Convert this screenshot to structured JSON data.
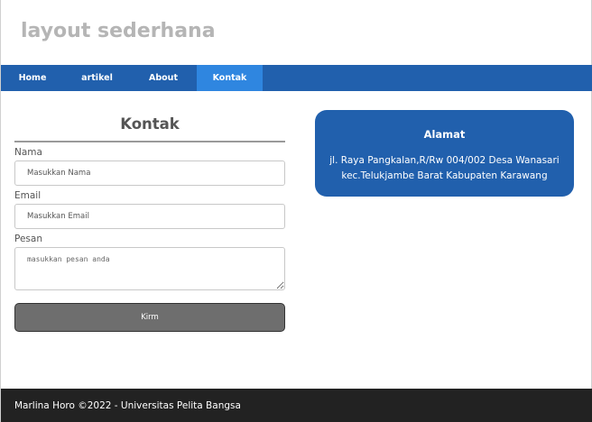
{
  "header": {
    "title": "layout sederhana"
  },
  "nav": {
    "items": [
      {
        "label": "Home"
      },
      {
        "label": "artikel"
      },
      {
        "label": "About"
      },
      {
        "label": "Kontak",
        "active": true
      }
    ]
  },
  "form": {
    "heading": "Kontak",
    "name_label": "Nama",
    "name_placeholder": "Masukkan Nama",
    "email_label": "Email",
    "email_placeholder": "Masukkan Email",
    "message_label": "Pesan",
    "message_placeholder": "masukkan pesan anda",
    "submit_label": "Kirm"
  },
  "address": {
    "title": "Alamat",
    "line1": "jl. Raya Pangkalan,R/Rw 004/002 Desa Wanasari",
    "line2": "kec.Telukjambe Barat Kabupaten Karawang"
  },
  "footer": {
    "text": "Marlina Horo ©2022 - Universitas Pelita Bangsa"
  },
  "colors": {
    "nav_bg": "#2160ad",
    "nav_active": "#2f86e0",
    "card_bg": "#2160ad",
    "button_bg": "#6e6e6e",
    "footer_bg": "#222222",
    "title_color": "#b5b5b5"
  }
}
